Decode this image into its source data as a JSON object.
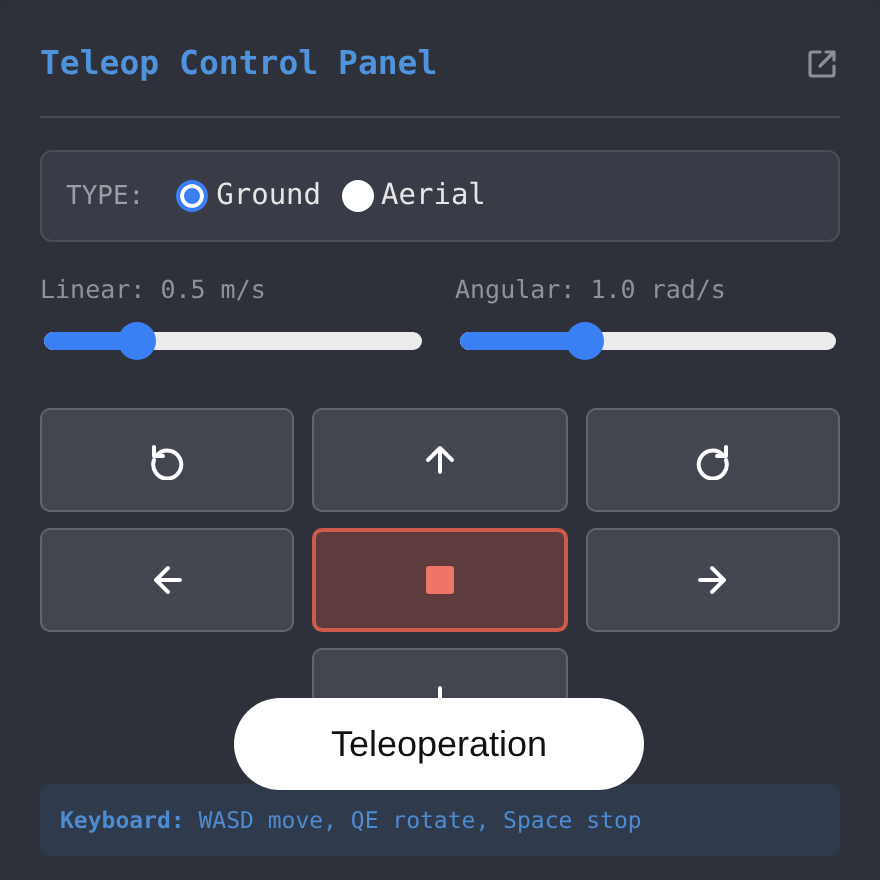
{
  "panel": {
    "title": "Teleop Control Panel"
  },
  "type_selector": {
    "label": "TYPE:",
    "options": [
      {
        "label": "Ground",
        "selected": true
      },
      {
        "label": "Aerial",
        "selected": false
      }
    ]
  },
  "sliders": [
    {
      "label": "Linear: 0.5 m/s",
      "level": 0.245
    },
    {
      "label": "Angular: 1.0 rad/s",
      "level": 0.33
    }
  ],
  "controls": [
    {
      "kind": "rotate_left"
    },
    {
      "kind": "forward"
    },
    {
      "kind": "rotate_right"
    },
    {
      "kind": "left"
    },
    {
      "kind": "stop"
    },
    {
      "kind": "right"
    },
    {
      "kind": "backward"
    }
  ],
  "keyboard_hint": "**Keyboard:** WASD move, QE rotate, Space stop",
  "caption": "Teleoperation"
}
